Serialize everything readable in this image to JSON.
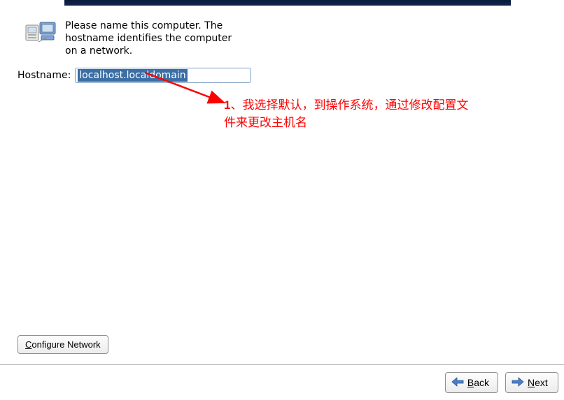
{
  "prompt": {
    "text": "Please name this computer.  The hostname identifies the computer on a network."
  },
  "hostname": {
    "label": "Hostname:",
    "value": "localhost.localdomain"
  },
  "annotation": {
    "number": "1",
    "text": "、我选择默认，到操作系统，通过修改配置文件来更改主机名"
  },
  "buttons": {
    "configure_prefix_underline": "C",
    "configure_rest": "onfigure Network",
    "back_prefix_underline": "B",
    "back_rest": "ack",
    "next_prefix_underline": "N",
    "next_rest": "ext"
  }
}
